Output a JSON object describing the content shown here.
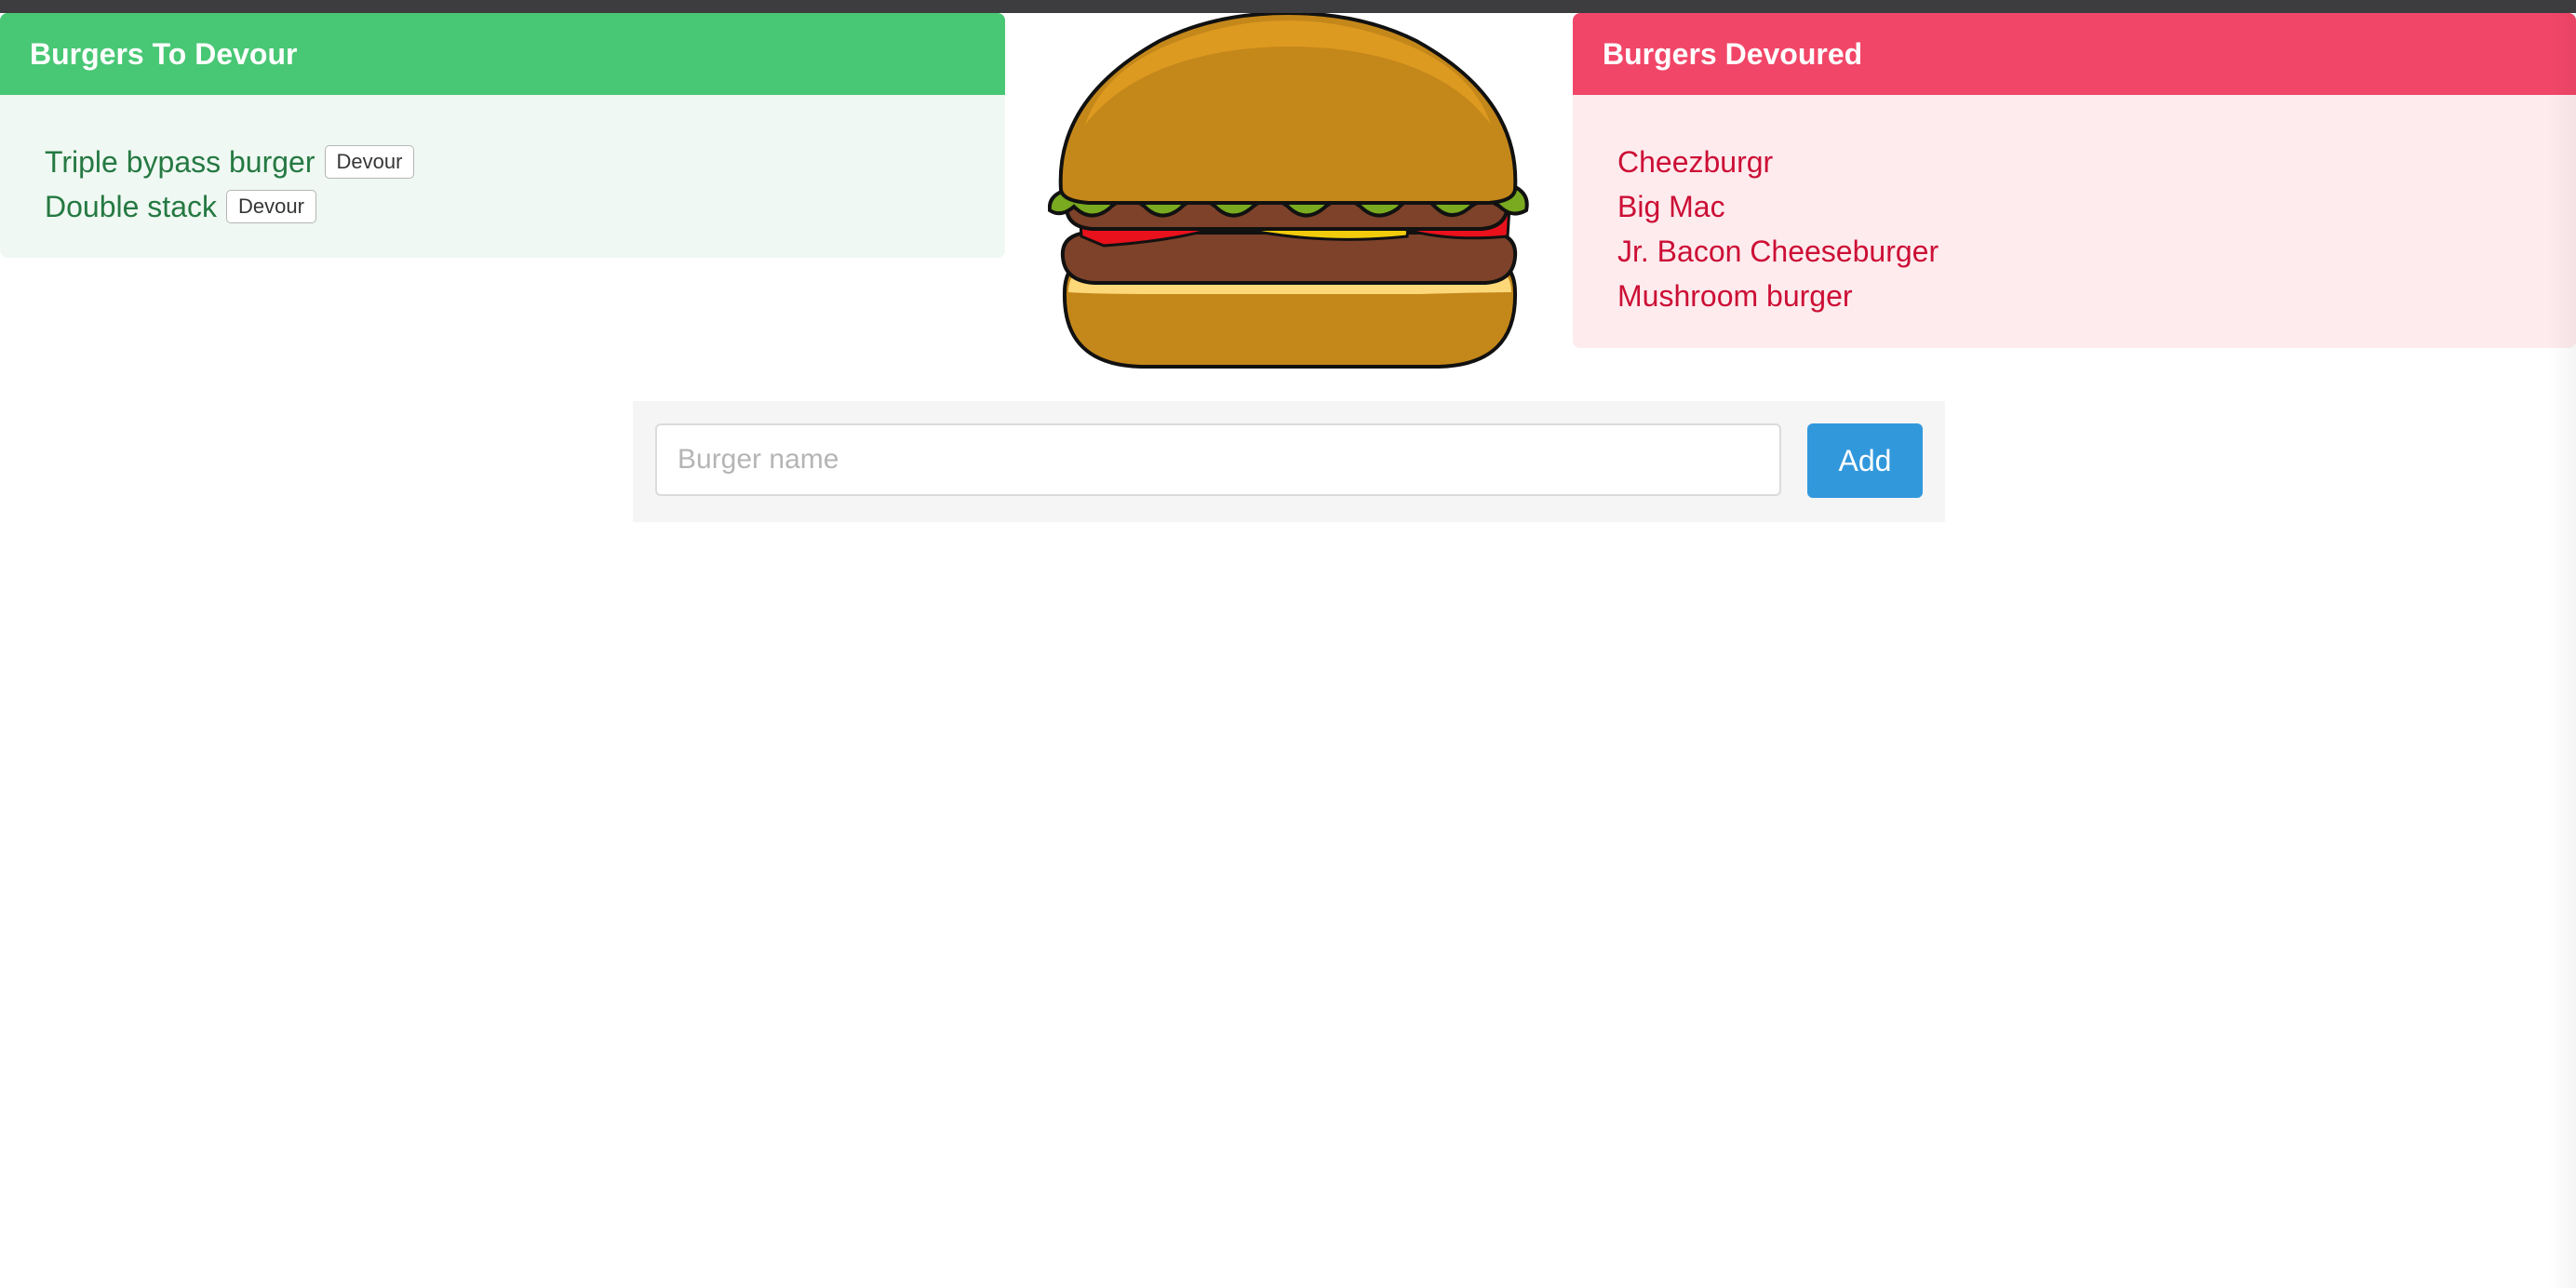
{
  "to_devour": {
    "title": "Burgers To Devour",
    "devour_label": "Devour",
    "items": [
      {
        "name": "Triple bypass burger"
      },
      {
        "name": "Double stack"
      }
    ]
  },
  "devoured": {
    "title": "Burgers Devoured",
    "items": [
      {
        "name": "Cheezburgr"
      },
      {
        "name": "Big Mac"
      },
      {
        "name": "Jr. Bacon Cheeseburger"
      },
      {
        "name": "Mushroom burger"
      }
    ]
  },
  "burger_image": {
    "icon": "burger-illustration"
  },
  "form": {
    "placeholder": "Burger name",
    "value": "",
    "add_label": "Add"
  },
  "colors": {
    "success": "#48c774",
    "danger": "#f14668",
    "info": "#3298dc"
  }
}
